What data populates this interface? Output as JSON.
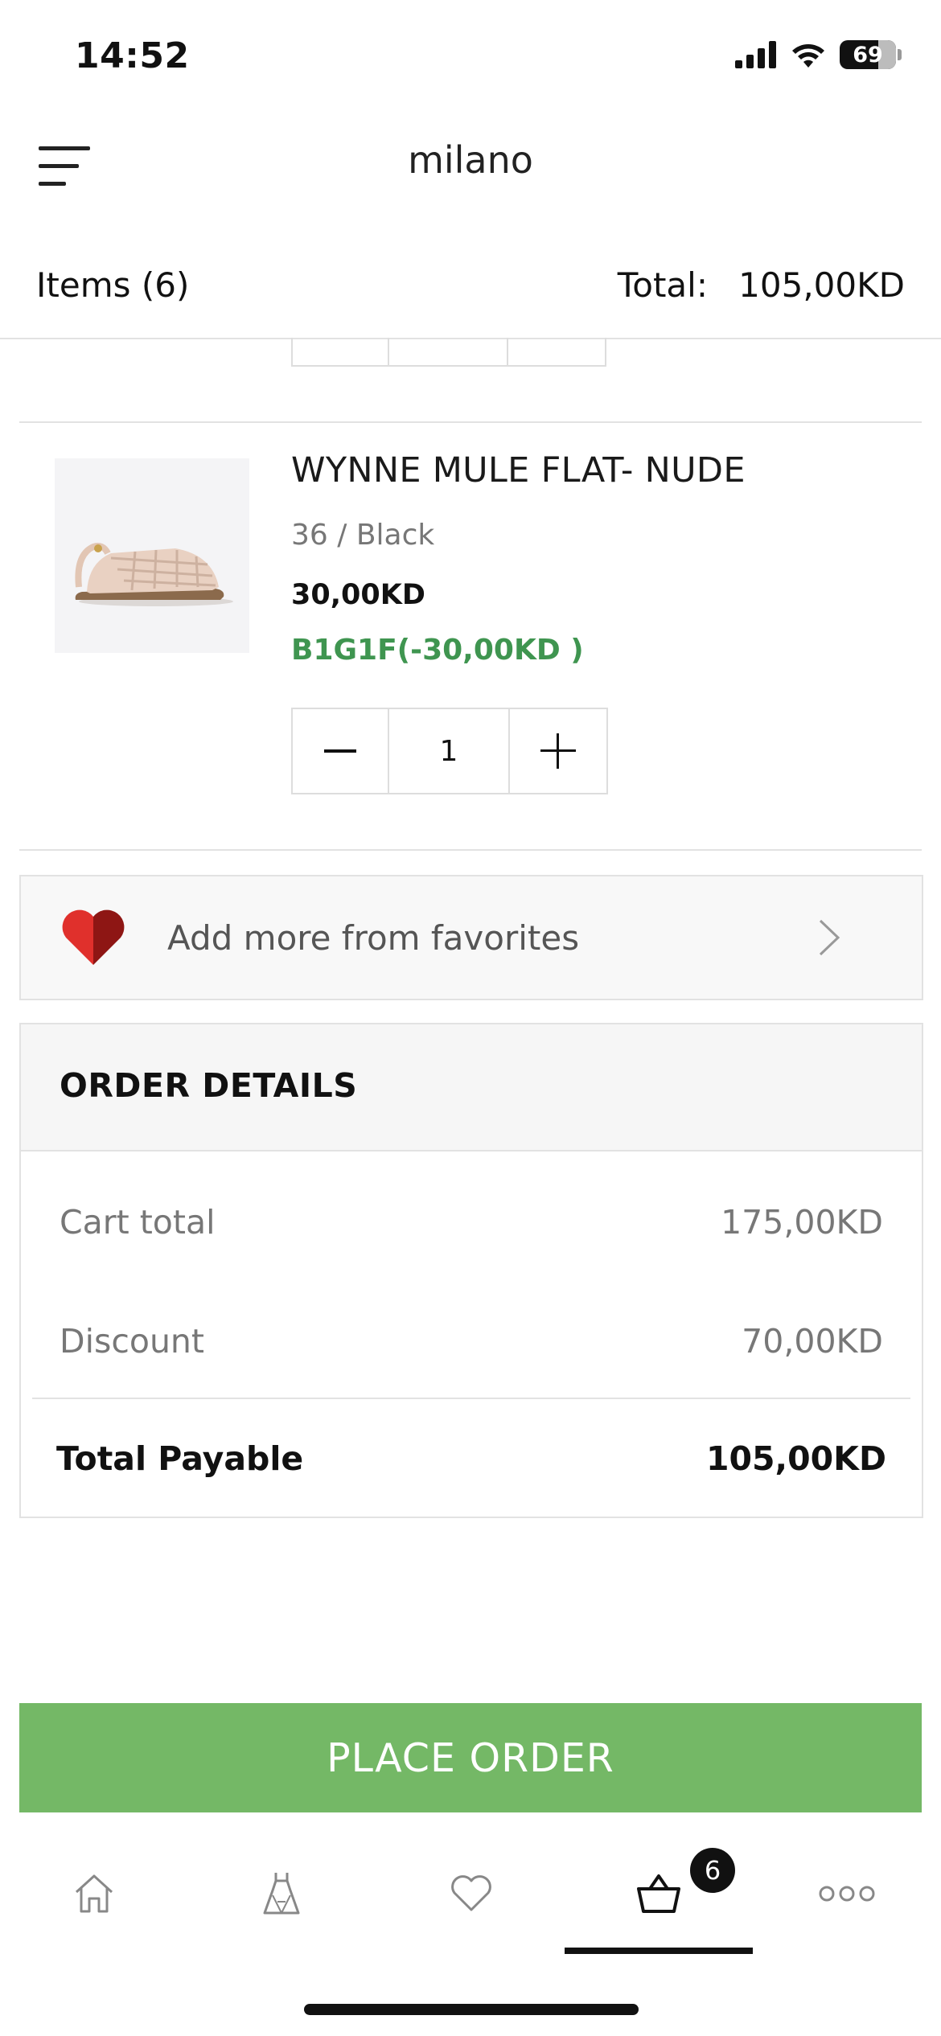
{
  "status_bar": {
    "time": "14:52",
    "battery": "69"
  },
  "header": {
    "logo": "milano"
  },
  "summary": {
    "items_label": "Items (6)",
    "total_label": "Total:",
    "total_value": "105,00KD"
  },
  "cart_item": {
    "name": "WYNNE MULE FLAT- NUDE",
    "variant": "36 / Black",
    "price": "30,00KD",
    "promo": "B1G1F(-30,00KD )",
    "quantity": "1"
  },
  "favorites": {
    "label": "Add more from favorites"
  },
  "order_details": {
    "title": "ORDER DETAILS",
    "cart_total_label": "Cart total",
    "cart_total_value": "175,00KD",
    "discount_label": "Discount",
    "discount_value": "70,00KD",
    "total_payable_label": "Total Payable",
    "total_payable_value": "105,00KD"
  },
  "place_order_label": "PLACE ORDER",
  "tab_bar": {
    "tabs": [
      "home-icon",
      "dress-icon",
      "heart-icon",
      "basket-icon",
      "more-icon"
    ],
    "cart_badge": "6",
    "active": "basket-icon"
  },
  "colors": {
    "accent_green": "#74b866",
    "promo_green": "#3f9550",
    "heart_red": "#d42b2b"
  }
}
